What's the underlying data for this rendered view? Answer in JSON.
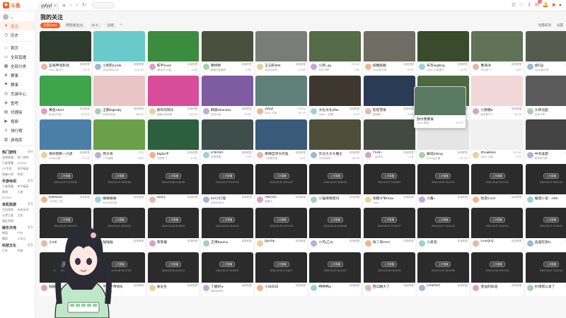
{
  "app": {
    "logo_text": "斗鱼"
  },
  "tabs": [
    {
      "label": "yyfyyf"
    }
  ],
  "sidebar": {
    "items": [
      {
        "label": "关注",
        "icon": "heart-icon",
        "active": true
      },
      {
        "label": "历史",
        "icon": "clock-icon"
      },
      {
        "label": "首页",
        "icon": "home-icon"
      },
      {
        "label": "全部直播",
        "icon": "tv-icon"
      },
      {
        "label": "全部分类",
        "icon": "grid-icon"
      },
      {
        "label": "赛事",
        "icon": "trophy-icon"
      },
      {
        "label": "赛事",
        "icon": "flag-icon"
      },
      {
        "label": "页游中心",
        "icon": "gamepad-icon"
      },
      {
        "label": "鱼吧",
        "icon": "fish-icon"
      },
      {
        "label": "代理商",
        "icon": "store-icon"
      },
      {
        "label": "视频",
        "icon": "video-icon"
      },
      {
        "label": "排行榜",
        "icon": "rank-icon"
      },
      {
        "label": "游戏库",
        "icon": "library-icon"
      }
    ],
    "sections": [
      {
        "title": "热门游戏",
        "more": "更多",
        "cats": [
          "英雄联盟",
          "热门游戏",
          "王者荣耀",
          "DOTA2",
          "CF手游",
          "和平精英",
          "穿越火线",
          "其他"
        ]
      },
      {
        "title": "手游休闲",
        "more": "更多",
        "cats": [
          "王者荣耀",
          "和平精英",
          "原神",
          "王者",
          "DOTA2"
        ]
      },
      {
        "title": "单机热游",
        "more": "更多",
        "cats": [
          "主机游戏",
          "永劫无间",
          "元梦之星",
          "主机",
          "暗区突围"
        ]
      },
      {
        "title": "娱乐天地",
        "more": "更多",
        "cats": [
          "颜值",
          "户外",
          "舞蹈",
          "二次元"
        ]
      },
      {
        "title": "科技文化",
        "more": "更多",
        "cats": [
          "汽车",
          "科普"
        ]
      }
    ]
  },
  "page": {
    "title": "我的关注",
    "filters": [
      {
        "label": "全部(151)",
        "active": true
      },
      {
        "label": "特别关注(3)"
      },
      {
        "label": "Di K"
      },
      {
        "label": "分组"
      }
    ],
    "top_right": [
      "批量取消",
      "设置"
    ]
  },
  "cards": [
    {
      "name": "蓝海神话影视",
      "cat": "英雄联盟",
      "sub": "dota2 看太久",
      "cnt": "6.1万",
      "color": "#2d3b2f",
      "type": "live"
    },
    {
      "name": "小鹤的Linda",
      "cat": "英雄联盟",
      "sub": "欢迎来到Linda",
      "cnt": "114.2万",
      "color": "#6ac9cb",
      "type": "live"
    },
    {
      "name": "陈宇Kuan",
      "cat": "英雄联盟",
      "sub": "(看官方)斗鱼",
      "cnt": "3.6万",
      "color": "#3c8c3f",
      "type": "live"
    },
    {
      "name": "黄杨柳",
      "cat": "英雄联盟",
      "sub": "鹤鹤的直播间",
      "cnt": "5.5万",
      "color": "#4a4f3e",
      "type": "live"
    },
    {
      "name": "王记的666",
      "cat": "英雄联盟",
      "sub": "欢迎大家来",
      "cnt": "12.5万",
      "color": "#7a7c79",
      "type": "live"
    },
    {
      "name": "小珂_qq",
      "cat": "DOTA2",
      "sub": "欢乐卡牌",
      "cnt": "1.6万",
      "color": "#556a46",
      "type": "live"
    },
    {
      "name": "核糖核酸",
      "cat": "英雄联盟",
      "sub": "dota2的日常",
      "cnt": "8.1万",
      "color": "#6f6c63",
      "type": "live"
    },
    {
      "name": "布丰wgkling",
      "cat": "英雄联盟",
      "sub": "dota2 大师操作",
      "cnt": "11.2万",
      "color": "#3a4b2c",
      "type": "live"
    },
    {
      "name": "黄海洋",
      "cat": "英雄联盟",
      "sub": "专注带飞",
      "cnt": "4.5万",
      "color": "#607357",
      "type": "live"
    },
    {
      "name": "虐打jjl",
      "cat": "英雄联盟",
      "sub": "dota2高分局",
      "cnt": "2.7万",
      "color": "#575b4f",
      "type": "live"
    },
    {
      "name": "黄鱼Abird",
      "cat": "英雄联盟",
      "sub": "新活动开始",
      "cnt": "123.8万",
      "color": "#3fa54c",
      "type": "live"
    },
    {
      "name": "王鹏bigbaby",
      "cat": "英雄联盟",
      "sub": "听我说说话",
      "cnt": "88.5万",
      "color": "#e9c5c5",
      "type": "live"
    },
    {
      "name": "新年的快乐",
      "cat": "英雄联盟",
      "sub": "宝藏女孩来袭",
      "cnt": "146.0万",
      "color": "#d84c9a",
      "type": "live"
    },
    {
      "name": "韩森Okemfox",
      "cat": "英雄联盟",
      "sub": "欢迎大家",
      "cnt": "15.6万",
      "color": "#7f5ca1",
      "type": "live"
    },
    {
      "name": "yyfyyf",
      "cat": "DOTA2",
      "sub": "dota2 中单",
      "cnt": "28.7万",
      "color": "#5f7f79",
      "type": "live"
    },
    {
      "name": "文化文化vffer",
      "cat": "英雄联盟",
      "sub": "dota2 一起看",
      "cnt": "6.1万",
      "color": "#3d372f",
      "type": "live"
    },
    {
      "name": "旺旺雪饼",
      "cat": "英雄联盟",
      "sub": "国服第一",
      "cnt": "8.3万",
      "color": "#2a3b55",
      "type": "live"
    },
    {
      "name": "发布局新",
      "cat": "英雄联盟",
      "sub": "今日开心",
      "cnt": "2.1万",
      "color": "#4c6a3f",
      "type": "live"
    },
    {
      "name": "小唐糖Z",
      "cat": "英雄联盟",
      "sub": "每天都开心",
      "cnt": "55.1万",
      "color": "#f1d7d8",
      "type": "live"
    },
    {
      "name": "大师兄超",
      "cat": "英雄联盟",
      "sub": "技术分享",
      "cnt": "17.2万",
      "color": "#5a5a5a",
      "type": "live"
    },
    {
      "name": "德州街跑一只虎",
      "cat": "英雄联盟",
      "sub": "dota2比赛",
      "cnt": "24.1万",
      "color": "#4a7fa8",
      "type": "live"
    },
    {
      "name": "周大哥",
      "cat": "户外",
      "sub": "户外直播",
      "cnt": "3.8万",
      "color": "#6aa04a",
      "type": "live"
    },
    {
      "name": "Bigfat子",
      "cat": "英雄联盟",
      "sub": "大神带飞",
      "cnt": "11.5万",
      "color": "#2b5f3e",
      "type": "live"
    },
    {
      "name": "ICIKING",
      "cat": "英雄联盟",
      "sub": "英雄联盟",
      "cnt": "9.2万",
      "color": "#3e4e4a",
      "type": "live"
    },
    {
      "name": "麻辣自然大的鱼",
      "cat": "英雄联盟",
      "sub": "一起看比赛",
      "cnt": "5.4万",
      "color": "#3a5a7a",
      "type": "live"
    },
    {
      "name": "东北大大大魔王",
      "cat": "英雄联盟",
      "sub": "今天的操作",
      "cnt": "18.9万",
      "color": "#4e4f3a",
      "type": "live"
    },
    {
      "name": "7149~",
      "cat": "英雄联盟",
      "sub": "一起来玩",
      "cnt": "1.2万",
      "color": "#434a40",
      "type": "live"
    },
    {
      "name": "解说Zileng",
      "cat": "英雄联盟",
      "sub": "[Zileng]主播",
      "cnt": "44.1万",
      "color": "#e5e5e5",
      "type": "live"
    },
    {
      "name": "ZhoaBoks",
      "cat": "DOTA2",
      "sub": "dota2 主播",
      "cnt": "6.7万",
      "color": "#f0f0f0",
      "type": "live"
    },
    {
      "name": "中央凌晨",
      "cat": "英雄联盟",
      "sub": "新年新气象",
      "cnt": "3.3万",
      "color": "#444",
      "type": "live"
    },
    {
      "name": "lewisxxin",
      "cat": "英雄联盟",
      "sub": "【中年】【5】",
      "cnt": "",
      "color": "#2b2b2b",
      "type": "replay",
      "pill": "上次直播",
      "time": "2024-03-27 14:29:18"
    },
    {
      "name": "磁磁磁磁",
      "cat": "英雄联盟",
      "sub": "dota2的日常",
      "cnt": "",
      "color": "#2b2b2b",
      "type": "replay",
      "pill": "上次直播",
      "time": "2024-03-27 15:09:55"
    },
    {
      "name": "s2xcy",
      "cat": "英雄联盟",
      "sub": "...",
      "cnt": "",
      "color": "#2b2b2b",
      "type": "replay",
      "pill": "上次直播",
      "time": "2024-04-08 11:45:08"
    },
    {
      "name": "Kirl小灯笼",
      "cat": "英雄联盟",
      "sub": "欢迎来到Kirl",
      "cnt": "",
      "color": "#2b2b2b",
      "type": "replay",
      "pill": "上次直播",
      "time": "2024-03-27 09:22:00"
    },
    {
      "name": "AMAXA",
      "cat": "英雄联盟",
      "sub": "直播中",
      "cnt": "",
      "color": "#2b2b2b",
      "type": "replay",
      "pill": "上次直播",
      "time": "2024-03-26 15:21:07"
    },
    {
      "name": "小猫嘻嘻回归",
      "cat": "英雄联盟",
      "sub": "",
      "cnt": "",
      "color": "#2b2b2b",
      "type": "replay",
      "pill": "上次直播",
      "time": "2024-03-20 23:56:31"
    },
    {
      "name": "张鹏大爷Dota",
      "cat": "英雄联盟",
      "sub": "dota2",
      "cnt": "",
      "color": "#2b2b2b",
      "type": "replay",
      "pill": "上次直播",
      "time": "2024-03-27 16:20:57"
    },
    {
      "name": "小雅~",
      "cat": "英雄联盟",
      "sub": "",
      "cnt": "",
      "color": "#2b2b2b",
      "type": "replay",
      "pill": "上次直播",
      "time": "2024-03-20 15:01:11"
    },
    {
      "name": "他说Coc0",
      "cat": "英雄联盟",
      "sub": "",
      "cnt": "",
      "color": "#2b2b2b",
      "type": "replay",
      "pill": "上次直播",
      "time": "2024-03-26 15:11:21"
    },
    {
      "name": "推塔小说 - ABS",
      "cat": "英雄联盟",
      "sub": "",
      "cnt": "",
      "color": "#2b2b2b",
      "type": "replay",
      "pill": "上次直播",
      "time": "2024-03-27 18:01:15"
    },
    {
      "name": "小o3l",
      "cat": "英雄联盟",
      "sub": "",
      "cnt": "",
      "color": "#2b2b2b",
      "type": "replay",
      "pill": "上次直播",
      "time": "2024-03-27 23:24:03"
    },
    {
      "name": "陆陆陆",
      "cat": "英雄联盟",
      "sub": "",
      "cnt": "",
      "color": "#2b2b2b",
      "type": "replay",
      "pill": "上次直播",
      "time": "2024-03-27 10:53:31"
    },
    {
      "name": "茶茶酱",
      "cat": "英雄联盟",
      "sub": "",
      "cnt": "",
      "color": "#2b2b2b",
      "type": "replay",
      "pill": "上次直播",
      "time": "2024-03-26 09:08:09"
    },
    {
      "name": "王博Bauluo",
      "cat": "英雄联盟",
      "sub": "",
      "cnt": "",
      "color": "#2b2b2b",
      "type": "replay",
      "pill": "上次直播",
      "time": "2024-03-26 15:45:21"
    },
    {
      "name": "tgscbp",
      "cat": "英雄联盟",
      "sub": "",
      "cnt": "",
      "color": "#2b2b2b",
      "type": "replay",
      "pill": "上次直播",
      "time": "2024-03-29 10:21:03"
    },
    {
      "name": "小杰(乙5)",
      "cat": "英雄联盟",
      "sub": "",
      "cnt": "",
      "color": "#2b2b2b",
      "type": "replay",
      "pill": "上次直播",
      "time": "2024-03-26 15:09:38"
    },
    {
      "name": "张二哥OvO",
      "cat": "英雄联盟",
      "sub": "",
      "cnt": "",
      "color": "#2b2b2b",
      "type": "replay",
      "pill": "上次直播",
      "time": "2024-03-27 22:15:07"
    },
    {
      "name": "小黑泡",
      "cat": "英雄联盟",
      "sub": "",
      "cnt": "",
      "color": "#2b2b2b",
      "type": "replay",
      "pill": "上次直播",
      "time": "2024-03-27 10:41:43"
    },
    {
      "name": "LiuuQrQ",
      "cat": "英雄联盟",
      "sub": "",
      "cnt": "",
      "color": "#2b2b2b",
      "type": "replay",
      "pill": "上次直播",
      "time": "2024-03-27 18:40:21"
    },
    {
      "name": "迪迦吃饭f1",
      "cat": "英雄联盟",
      "sub": "",
      "cnt": "",
      "color": "#2b2b2b",
      "type": "replay",
      "pill": "上次直播",
      "time": "2024-03-27 12:30:11"
    },
    {
      "name": "陆陆地",
      "cat": "英雄联盟",
      "sub": "",
      "cnt": "",
      "color": "#2b2b2b",
      "type": "replay",
      "pill": "上次直播",
      "time": "2024-03-26 20:47:03"
    },
    {
      "name": "不迷卡帝快乐",
      "cat": "英雄联盟",
      "sub": "(二周目)",
      "cnt": "",
      "color": "#2b2b2b",
      "type": "replay",
      "pill": "上次直播",
      "time": "2024-03-26 20:47:03"
    },
    {
      "name": "爱夫生",
      "cat": "英雄联盟",
      "sub": "",
      "cnt": "",
      "color": "#2b2b2b",
      "type": "replay",
      "pill": "上次直播",
      "time": "2024-03-20 15:23:12"
    },
    {
      "name": "丁鹏炉w",
      "cat": "英雄联盟",
      "sub": "我的房间来",
      "cnt": "",
      "color": "#2b2b2b",
      "type": "replay",
      "pill": "上次直播",
      "time": "2024-03-22 15:05:21"
    },
    {
      "name": "小白白白",
      "cat": "英雄联盟",
      "sub": "",
      "cnt": "",
      "color": "#2b2b2b",
      "type": "replay",
      "pill": "上次直播",
      "time": "2024-04-08 11:18:17"
    },
    {
      "name": "鸭鸭鸭w",
      "cat": "英雄联盟",
      "sub": "",
      "cnt": "",
      "color": "#2b2b2b",
      "type": "replay",
      "pill": "上次直播",
      "time": "2024-03-20 14:14:07"
    },
    {
      "name": "西瓜翻大了",
      "cat": "英雄联盟",
      "sub": "",
      "cnt": "",
      "color": "#2b2b2b",
      "type": "replay",
      "pill": "上次直播",
      "time": "2024-10-18 18:04:00"
    },
    {
      "name": "LinaOvO",
      "cat": "英雄联盟",
      "sub": "",
      "cnt": "",
      "color": "#2b2b2b",
      "type": "replay",
      "pill": "上次直播",
      "time": "2024-01-20 18:09:00"
    },
    {
      "name": "斐迪的知道",
      "cat": "英雄联盟",
      "sub": "",
      "cnt": "",
      "color": "#2b2b2b",
      "type": "replay",
      "pill": "上次直播",
      "time": "2024-04-06 10:01:00"
    },
    {
      "name": "抄错错么发了",
      "cat": "英雄联盟",
      "sub": "",
      "cnt": "",
      "color": "#2b2b2b",
      "type": "replay",
      "pill": "上次直播",
      "time": "2024-03-27 13:04:41"
    }
  ],
  "popup": {
    "name": "放尔我要爱",
    "sub": "dota2 冒险",
    "cnt": "10.2万"
  },
  "colors": {
    "accent": "#ff5d23"
  }
}
